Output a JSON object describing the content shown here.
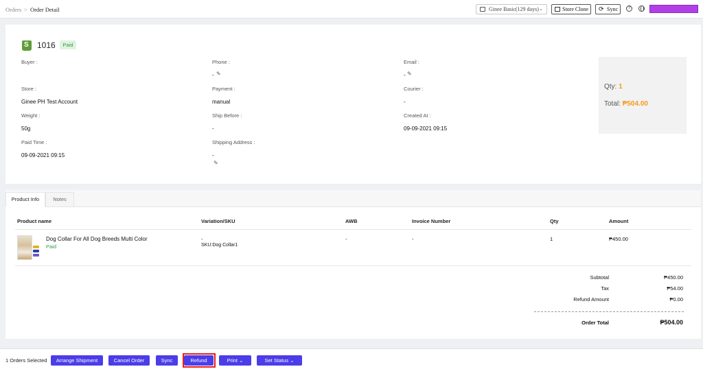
{
  "breadcrumb": {
    "parent": "Orders",
    "separator": ">",
    "current": "Order Detail"
  },
  "topbar": {
    "plan_label": "Ginee Basic(129 days)",
    "store_clone_label": "Store Clone",
    "sync_label": "Sync",
    "help_glyph": "?",
    "user_color": "#b23fe6"
  },
  "order": {
    "number": "1016",
    "status_badge": "Paid",
    "fields": {
      "buyer_label": "Buyer :",
      "buyer_value": "",
      "phone_label": "Phone :",
      "phone_value": "-",
      "email_label": "Email :",
      "email_value": "-",
      "store_label": "Store :",
      "store_value": "Ginee PH Test Account",
      "payment_label": "Payment :",
      "payment_value": "manual",
      "courier_label": "Courier :",
      "courier_value": "-",
      "weight_label": "Weight :",
      "weight_value": "50g",
      "ship_before_label": "Ship Before :",
      "ship_before_value": "-",
      "created_at_label": "Created At :",
      "created_at_value": "09-09-2021 09:15",
      "paid_time_label": "Paid Time :",
      "paid_time_value": "09-09-2021 09:15",
      "shipping_address_label": "Shipping Address :",
      "shipping_address_value": "-"
    },
    "summary": {
      "qty_label": "Qty:",
      "qty_value": "1",
      "total_label": "Total:",
      "total_value": "₱504.00"
    }
  },
  "tabs": [
    {
      "label": "Product Info",
      "active": true
    },
    {
      "label": "Notes",
      "active": false
    }
  ],
  "table": {
    "headers": [
      "Product name",
      "Variation/SKU",
      "AWB",
      "Invoice Number",
      "Qty",
      "Amount"
    ],
    "rows": [
      {
        "product_name": "Dog Collar For All Dog Breeds Multi Color",
        "status": "Paid",
        "variation": "-",
        "sku": "SKU:Dog Collar1",
        "awb": "-",
        "invoice": "-",
        "qty": "1",
        "amount": "₱450.00"
      }
    ]
  },
  "totals": {
    "subtotal_label": "Subtotal",
    "subtotal_value": "₱450.00",
    "tax_label": "Tax",
    "tax_value": "₱54.00",
    "refund_label": "Refund Amount",
    "refund_value": "₱0.00",
    "order_total_label": "Order Total",
    "order_total_value": "₱504.00"
  },
  "actions": {
    "selected_text": "1 Orders Selected",
    "arrange_shipment": "Arrange Shipment",
    "cancel_order": "Cancel Order",
    "sync": "Sync",
    "refund": "Refund",
    "print": "Print",
    "set_status": "Set Status",
    "accent_color": "#4b3de8",
    "highlight_color": "#e81c1c"
  }
}
